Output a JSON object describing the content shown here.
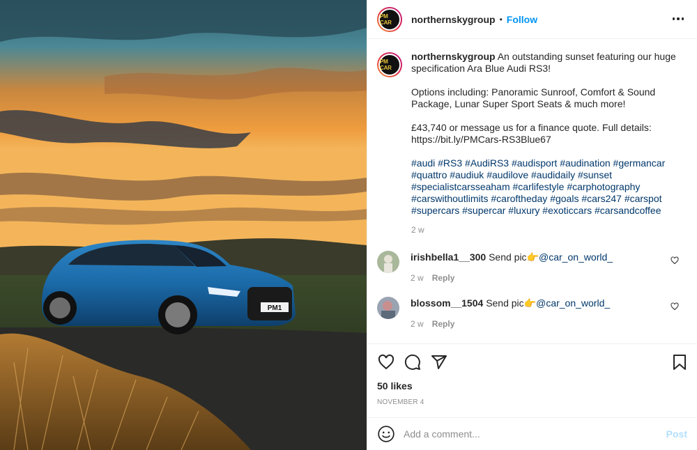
{
  "post": {
    "username": "northernskygroup",
    "separator": "•",
    "follow_label": "Follow",
    "avatar_text": "PM CAR",
    "plate_text": "PM1"
  },
  "caption": {
    "username": "northernskygroup",
    "line1": "An outstanding sunset featuring our huge specification Ara Blue Audi RS3!",
    "line2": "Options including: Panoramic Sunroof, Comfort & Sound Package, Lunar Super Sport Seats & much more!",
    "line3": "£43,740 or message us for a finance quote. Full details: https://bit.ly/PMCars-RS3Blue67",
    "hashtags": "#audi #RS3 #AudiRS3 #audisport #audination #germancar #quattro #audiuk #audilove #audidaily #sunset #specialistcarsseaham #carlifestyle #carphotography #carswithoutlimits #caroftheday #goals #cars247 #carspot #supercars #supercar #luxury #exoticcars #carsandcoffee",
    "time": "2 w"
  },
  "comments": [
    {
      "username": "irishbella1__300",
      "text": "Send pic👉",
      "mention": "@car_on_world_",
      "time": "2 w",
      "reply": "Reply"
    },
    {
      "username": "blossom__1504",
      "text": "Send pic👉",
      "mention": "@car_on_world_",
      "time": "2 w",
      "reply": "Reply"
    }
  ],
  "likes": "50 likes",
  "date": "NOVEMBER 4",
  "add_comment": {
    "placeholder": "Add a comment...",
    "post_label": "Post"
  },
  "colors": {
    "accent": "#0095f6",
    "hashtag": "#00376b",
    "muted": "#8e8e8e",
    "post_disabled": "#b2dffc"
  },
  "icons": [
    "more-icon",
    "heart-icon",
    "comment-icon",
    "share-icon",
    "bookmark-icon",
    "emoji-icon"
  ]
}
